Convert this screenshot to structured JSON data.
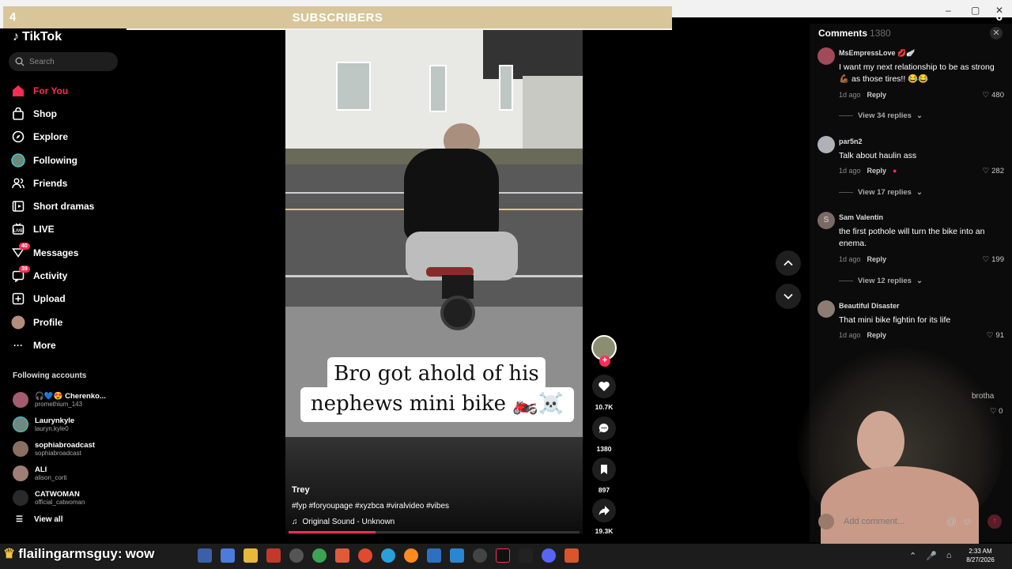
{
  "overlay": {
    "subscribers_label": "SUBSCRIBERS",
    "left_count": "4",
    "right_count": "6"
  },
  "sidebar": {
    "logo": "TikTok",
    "search_placeholder": "Search",
    "nav": [
      {
        "label": "For You",
        "icon": "home-icon",
        "active": true
      },
      {
        "label": "Shop",
        "icon": "shopping-bag-icon"
      },
      {
        "label": "Explore",
        "icon": "compass-icon"
      },
      {
        "label": "Following",
        "icon": "following-avatar-icon"
      },
      {
        "label": "Friends",
        "icon": "friends-icon"
      },
      {
        "label": "Short dramas",
        "icon": "dramas-icon"
      },
      {
        "label": "LIVE",
        "icon": "live-icon"
      },
      {
        "label": "Messages",
        "icon": "messages-icon",
        "badge": "40"
      },
      {
        "label": "Activity",
        "icon": "activity-icon",
        "badge": "39"
      },
      {
        "label": "Upload",
        "icon": "upload-icon"
      },
      {
        "label": "Profile",
        "icon": "profile-avatar-icon"
      },
      {
        "label": "More",
        "icon": "more-icon"
      }
    ],
    "following_title": "Following accounts",
    "following": [
      {
        "name": "🎧💙😍 Cherenko...",
        "handle": "promethium_143"
      },
      {
        "name": "Laurynkyle",
        "handle": "lauryn.kyle0"
      },
      {
        "name": "sophiabroadcast",
        "handle": "sophiabroadcast"
      },
      {
        "name": "ALI",
        "handle": "alison_corti"
      },
      {
        "name": "CATWOMAN",
        "handle": "official_catwoman"
      }
    ],
    "view_all": "View all"
  },
  "video": {
    "caption_line1": "Bro got ahold of his",
    "caption_line2": "nephews mini bike 🏍️☠️",
    "author": "Trey",
    "tags": "#fyp #foryoupage #xyzbca #viralvideo #vibes",
    "sound": "Original Sound - Unknown",
    "progress": 0.3
  },
  "actions": {
    "likes": "10.7K",
    "comments": "1380",
    "saves": "897",
    "shares": "19.3K"
  },
  "comments": {
    "title": "Comments",
    "count": "1380",
    "items": [
      {
        "user": "MsEmpressLove 💋🪽",
        "text": "I want my next relationship to be as strong 💪🏾 as those tires!! 😂😂",
        "time": "1d ago",
        "reply": "Reply",
        "likes": "480",
        "view_replies": "View 34 replies"
      },
      {
        "user": "par5n2",
        "text": "Talk about haulin ass",
        "time": "1d ago",
        "reply": "Reply",
        "likes": "282",
        "view_replies": "View 17 replies"
      },
      {
        "user": "Sam Valentin",
        "text": "the first pothole will turn the bike into an enema.",
        "time": "1d ago",
        "reply": "Reply",
        "likes": "199",
        "view_replies": "View 12 replies",
        "initial": "S"
      },
      {
        "user": "Beautiful Disaster",
        "text": "That mini bike fightin for its life",
        "time": "1d ago",
        "reply": "Reply",
        "likes": "91"
      }
    ],
    "partial_text": "brotha",
    "partial_likes": "0",
    "input_placeholder": "Add comment..."
  },
  "taskbar": {
    "chat_user": "flailingarmsguy:",
    "chat_message": "wow",
    "time": "2:33 AM",
    "date": "8/27/2026"
  },
  "colors": {
    "accent": "#fe2c55",
    "banner": "#d8c69a"
  }
}
